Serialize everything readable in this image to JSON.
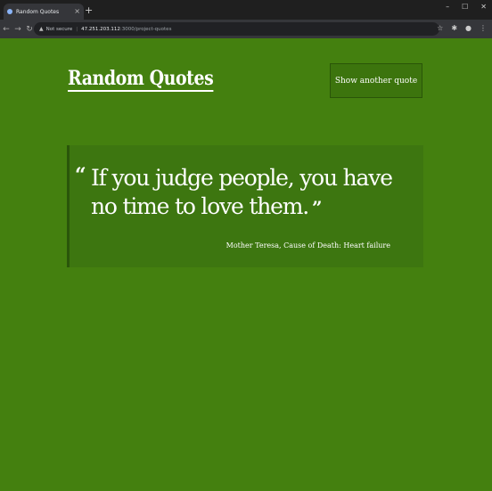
{
  "browser": {
    "tab_title": "Random Quotes",
    "tab_close": "×",
    "new_tab": "+",
    "window_controls": {
      "minimize": "–",
      "maximize": "☐",
      "close": "✕"
    },
    "nav": {
      "back": "←",
      "forward": "→",
      "reload": "↻"
    },
    "omnibox": {
      "security_icon": "warning-icon",
      "security_label": "Not secure",
      "host": "47.251.203.112",
      "path": ":3000/project-quotes"
    },
    "toolbar_icons": [
      "star-icon",
      "extensions-icon",
      "profile-icon",
      "menu-icon"
    ]
  },
  "page": {
    "background": "#44800f",
    "title": "Random Quotes",
    "next_button_label": "Show another quote",
    "quote": {
      "open_mark": "“",
      "text": "If you judge people, you have no time to love them.",
      "close_mark": "”",
      "author": "Mother Teresa, Cause of Death: Heart failure"
    }
  }
}
